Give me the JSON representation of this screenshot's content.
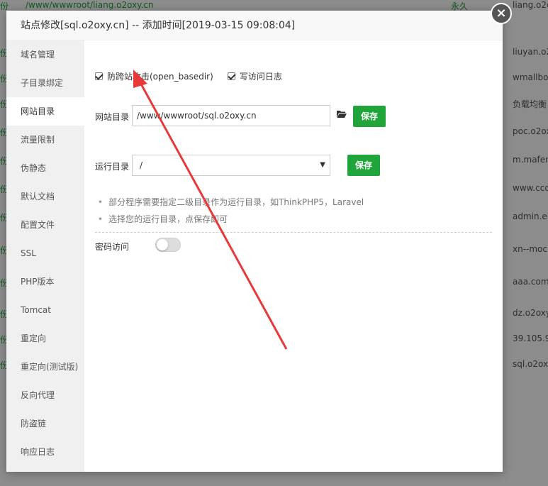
{
  "background": {
    "top_path": "/www/wwwroot/liang.o2oxy.cn",
    "top_perm": "永久",
    "left_prefix": "份",
    "right_domains": [
      "liang.o2oxy.cn",
      "liuyan.o2",
      "wmallbo",
      "负载均衡",
      "poc.o2ox",
      "m.mafen",
      "www.ccc",
      "admin.ei",
      "xn--moc",
      "aaa.com",
      "dz.o2oxy",
      "39.105.9",
      "sql.o2ox"
    ]
  },
  "modal": {
    "title": "站点修改[sql.o2oxy.cn] -- 添加时间[2019-03-15 09:08:04]",
    "close": "×"
  },
  "sidebar": {
    "items": [
      {
        "label": "域名管理"
      },
      {
        "label": "子目录绑定"
      },
      {
        "label": "网站目录"
      },
      {
        "label": "流量限制"
      },
      {
        "label": "伪静态"
      },
      {
        "label": "默认文档"
      },
      {
        "label": "配置文件"
      },
      {
        "label": "SSL"
      },
      {
        "label": "PHP版本"
      },
      {
        "label": "Tomcat"
      },
      {
        "label": "重定向"
      },
      {
        "label": "重定向(测试版)"
      },
      {
        "label": "反向代理"
      },
      {
        "label": "防盗链"
      },
      {
        "label": "响应日志"
      }
    ],
    "active": "网站目录"
  },
  "content": {
    "checkbox_open_basedir": "防跨站攻击(open_basedir)",
    "checkbox_access_log": "写访问日志",
    "site_dir_label": "网站目录",
    "site_dir_value": "/www/wwwroot/sql.o2oxy.cn",
    "save_label": "保存",
    "run_dir_label": "运行目录",
    "run_dir_value": "/",
    "tips": [
      "部分程序需要指定二级目录作为运行目录，如ThinkPHP5，Laravel",
      "选择您的运行目录，点保存即可"
    ],
    "password_access_label": "密码访问",
    "password_access_on": false
  },
  "colors": {
    "accent_green": "#20a53a",
    "annotation_red": "#e8393a"
  }
}
